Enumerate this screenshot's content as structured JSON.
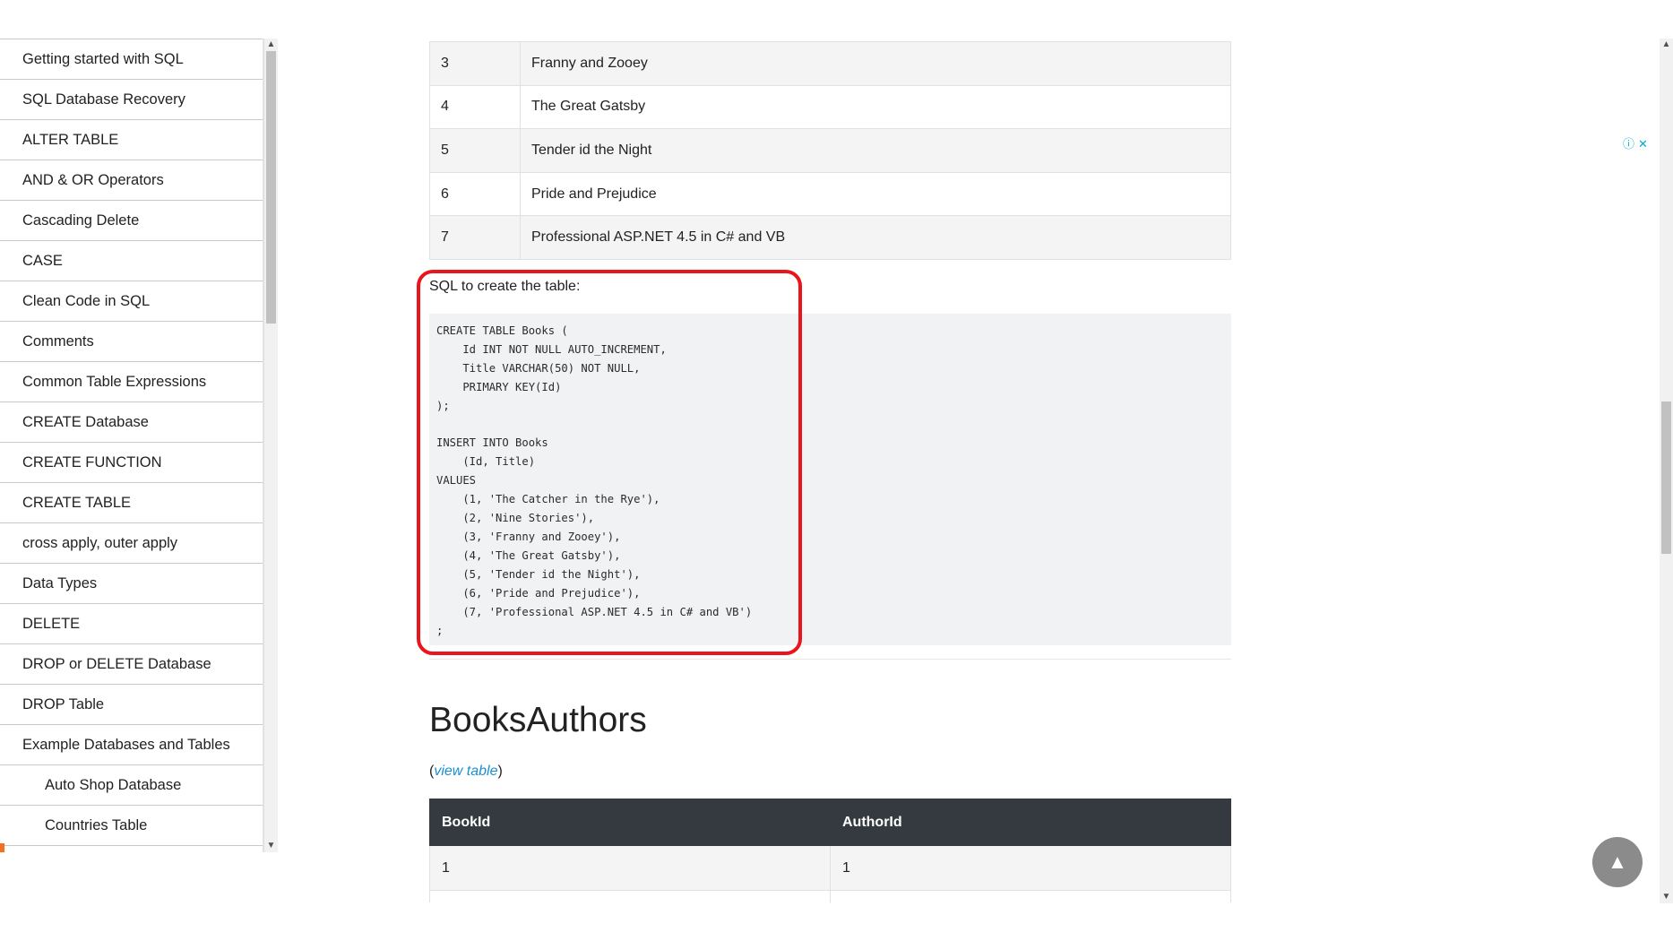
{
  "sidebar": {
    "items": [
      {
        "label": "Getting started with SQL"
      },
      {
        "label": "SQL Database Recovery"
      },
      {
        "label": "ALTER TABLE"
      },
      {
        "label": "AND & OR Operators"
      },
      {
        "label": "Cascading Delete"
      },
      {
        "label": "CASE"
      },
      {
        "label": "Clean Code in SQL"
      },
      {
        "label": "Comments"
      },
      {
        "label": "Common Table Expressions"
      },
      {
        "label": "CREATE Database"
      },
      {
        "label": "CREATE FUNCTION"
      },
      {
        "label": "CREATE TABLE"
      },
      {
        "label": "cross apply, outer apply"
      },
      {
        "label": "Data Types"
      },
      {
        "label": "DELETE"
      },
      {
        "label": "DROP or DELETE Database"
      },
      {
        "label": "DROP Table"
      },
      {
        "label": "Example Databases and Tables"
      },
      {
        "label": "Auto Shop Database"
      },
      {
        "label": "Countries Table"
      }
    ]
  },
  "books_table": {
    "rows": [
      {
        "id": "3",
        "title": "Franny and Zooey"
      },
      {
        "id": "4",
        "title": "The Great Gatsby"
      },
      {
        "id": "5",
        "title": "Tender id the Night"
      },
      {
        "id": "6",
        "title": "Pride and Prejudice"
      },
      {
        "id": "7",
        "title": "Professional ASP.NET 4.5 in C# and VB"
      }
    ]
  },
  "sql_caption": "SQL to create the table:",
  "sql_code": "CREATE TABLE Books (\n    Id INT NOT NULL AUTO_INCREMENT,\n    Title VARCHAR(50) NOT NULL,\n    PRIMARY KEY(Id)\n);\n\nINSERT INTO Books\n    (Id, Title)\nVALUES\n    (1, 'The Catcher in the Rye'),\n    (2, 'Nine Stories'),\n    (3, 'Franny and Zooey'),\n    (4, 'The Great Gatsby'),\n    (5, 'Tender id the Night'),\n    (6, 'Pride and Prejudice'),\n    (7, 'Professional ASP.NET 4.5 in C# and VB')\n;",
  "books_authors": {
    "title": "BooksAuthors",
    "view_paren_open": "(",
    "view_link": "view table",
    "view_paren_close": ")",
    "headers": [
      "BookId",
      "AuthorId"
    ],
    "rows": [
      [
        "1",
        "1"
      ],
      [
        "",
        ""
      ]
    ]
  },
  "ad": {
    "info_icon": "ⓘ",
    "close_icon": "✕"
  },
  "icons": {
    "back_to_top": "chevron-up-icon",
    "scroll_up": "▲",
    "scroll_down": "▼",
    "back_top_glyph": "▲"
  },
  "colors": {
    "highlight": "#e8161c",
    "table_header": "#343a40",
    "link": "#1a8fd1",
    "accent": "#f36f21"
  }
}
